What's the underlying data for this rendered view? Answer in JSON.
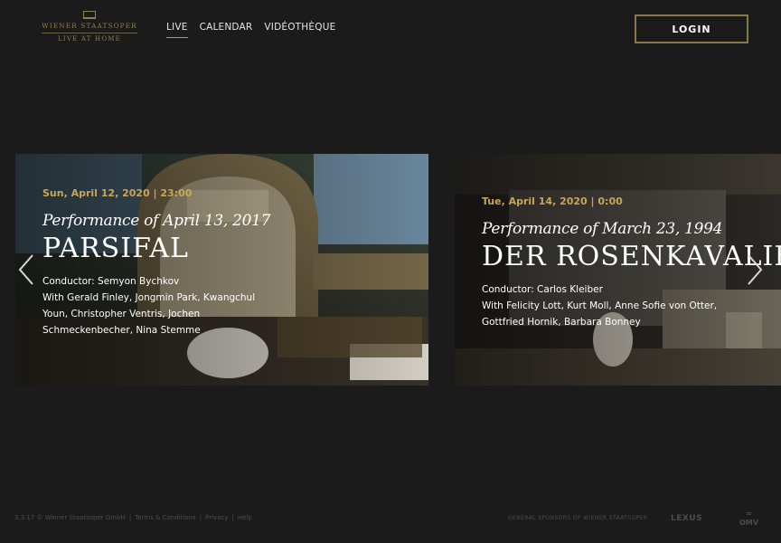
{
  "header": {
    "logo_line1": "WIENER STAATSOPER",
    "logo_line2": "LIVE AT HOME",
    "nav": [
      {
        "label": "LIVE",
        "active": true
      },
      {
        "label": "CALENDAR",
        "active": false
      },
      {
        "label": "VIDÉOTHÈQUE",
        "active": false
      }
    ],
    "login_label": "LOGIN"
  },
  "slides": [
    {
      "date": "Sun, April 12, 2020 | 23:00",
      "performance": "Performance of April 13, 2017",
      "opera": "PARSIFAL",
      "conductor": "Conductor: Semyon Bychkov",
      "cast_lines": [
        "With Gerald Finley, Jongmin Park, Kwangchul",
        "Youn, Christopher Ventris, Jochen",
        "Schmeckenbecher, Nina Stemme"
      ]
    },
    {
      "date": "Tue, April 14, 2020 | 0:00",
      "performance": "Performance of March 23, 1994",
      "opera": "DER ROSENKAVALIER",
      "conductor": "Conductor: Carlos Kleiber",
      "cast_lines": [
        "With Felicity Lott, Kurt Moll, Anne Sofie von Otter,",
        "Gottfried Hornik, Barbara Bonney"
      ]
    }
  ],
  "footer": {
    "version": "3.3.17 © Wiener Staatsoper GmbH",
    "links": [
      "Terms & Conditions",
      "Privacy",
      "Help"
    ],
    "sponsors_label": "GENERAL SPONSORS OF WIENER STAATSOPER",
    "sponsor_lexus": "LEXUS",
    "sponsor_omv": "OMV"
  },
  "icons": {
    "prev": "chevron-left-icon",
    "next": "chevron-right-icon"
  }
}
